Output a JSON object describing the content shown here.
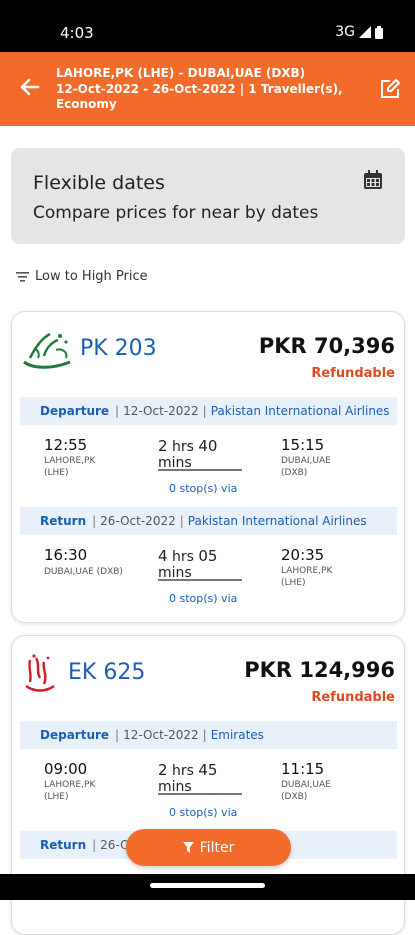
{
  "status_bar": {
    "time": "4:03",
    "network": "3G"
  },
  "header": {
    "route": "LAHORE,PK (LHE) - DUBAI,UAE (DXB)",
    "details": "12-Oct-2022 - 26-Oct-2022 | 1 Traveller(s), Economy"
  },
  "flexible": {
    "title": "Flexible dates",
    "subtitle": "Compare prices for near by dates"
  },
  "sort": {
    "label": "Low to High Price"
  },
  "flights": [
    {
      "flight_no": "PK 203",
      "price": "PKR 70,396",
      "refund": "Refundable",
      "departure": {
        "type": "Departure",
        "date": "12-Oct-2022",
        "airline": "Pakistan International Airlines",
        "dep_time": "12:55",
        "dep_city": "LAHORE,PK",
        "dep_code": "(LHE)",
        "dur_h": "2",
        "dur_m": "40",
        "arr_time": "15:15",
        "arr_city": "DUBAI,UAE",
        "arr_code": "(DXB)",
        "stops": "0 stop(s) via"
      },
      "return": {
        "type": "Return",
        "date": "26-Oct-2022",
        "airline": "Pakistan International Airlines",
        "dep_time": "16:30",
        "dep_city": "DUBAI,UAE (DXB)",
        "dur_h": "4",
        "dur_m": "05",
        "arr_time": "20:35",
        "arr_city": "LAHORE,PK",
        "arr_code": "(LHE)",
        "stops": "0 stop(s) via"
      }
    },
    {
      "flight_no": "EK 625",
      "price": "PKR 124,996",
      "refund": "Refundable",
      "departure": {
        "type": "Departure",
        "date": "12-Oct-2022",
        "airline": "Emirates",
        "dep_time": "09:00",
        "dep_city": "LAHORE,PK",
        "dep_code": "(LHE)",
        "dur_h": "2",
        "dur_m": "45",
        "arr_time": "11:15",
        "arr_city": "DUBAI,UAE",
        "arr_code": "(DXB)",
        "stops": "0 stop(s) via"
      },
      "return": {
        "type": "Return",
        "date": "26-O"
      }
    }
  ],
  "units": {
    "hrs": "hrs",
    "mins": "mins"
  },
  "filter": {
    "label": "Filter"
  },
  "colors": {
    "accent": "#f26b2a",
    "link": "#1a5fb4",
    "refund": "#e14a1e"
  },
  "icons": {
    "back": "arrow-left-icon",
    "edit": "edit-icon",
    "calendar": "calendar-icon",
    "sort": "sort-icon",
    "filter": "funnel-icon"
  }
}
